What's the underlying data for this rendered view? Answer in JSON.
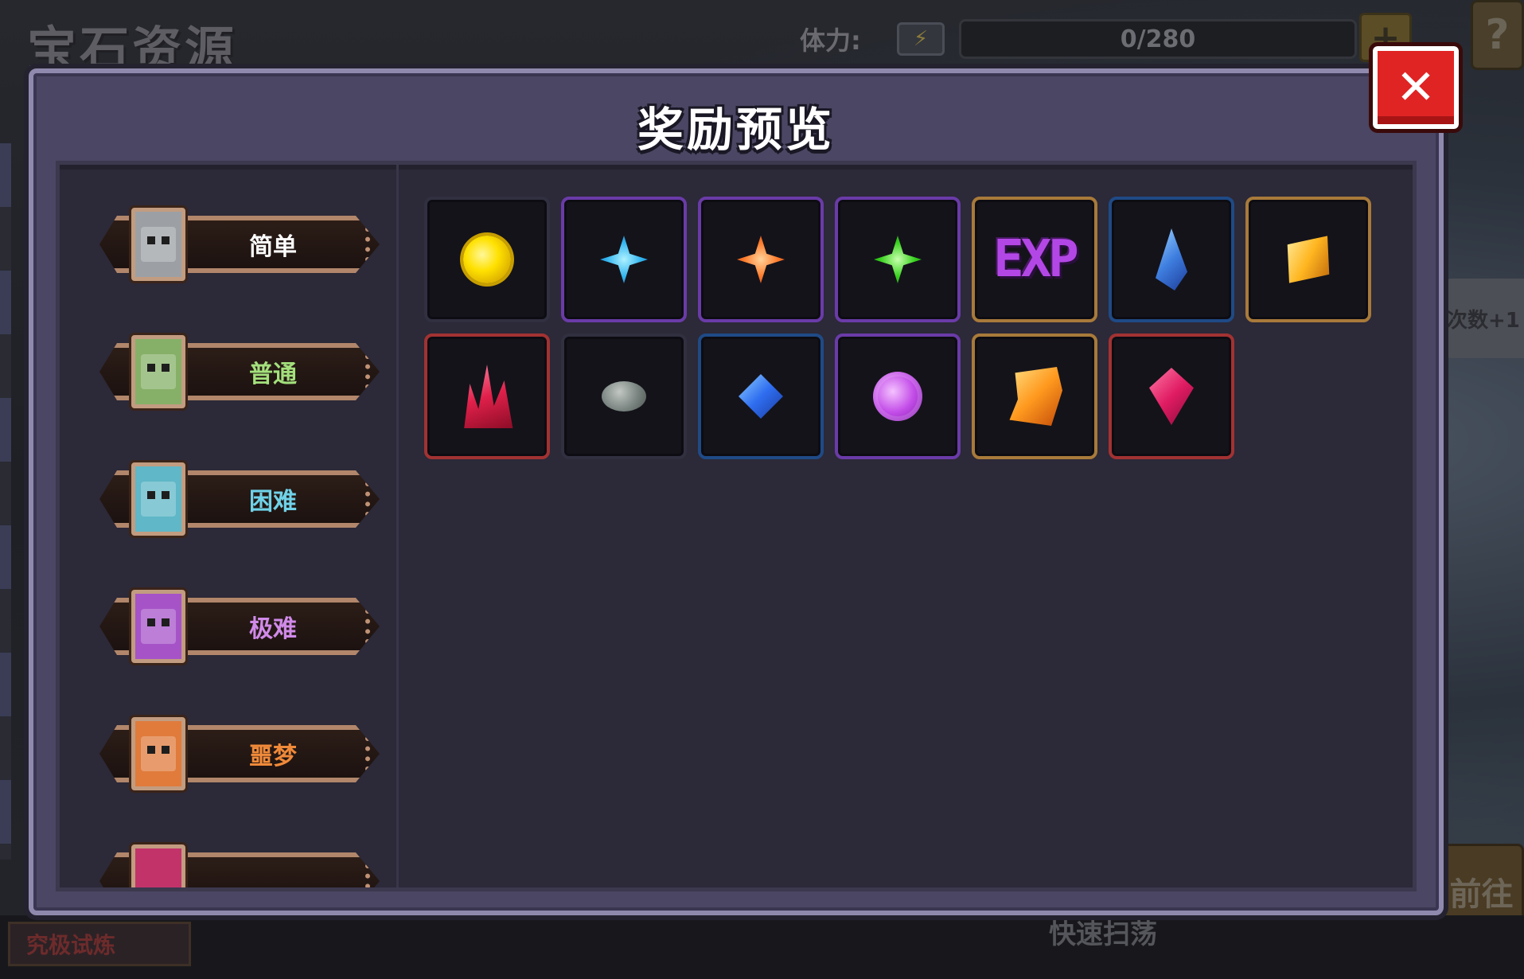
{
  "background": {
    "title": "宝石资源",
    "stamina_label": "体力:",
    "stamina_value": "0/280",
    "side_tag": "次数+1",
    "goto_label": "前往",
    "trial_label": "究极试炼",
    "sweep_label": "快速扫荡"
  },
  "modal": {
    "title": "奖励预览",
    "close_icon": "close-icon",
    "difficulties": [
      {
        "label": "简单",
        "color": "#ffffff",
        "icon_bg": "#9ca0a5",
        "frame": "#c29c80"
      },
      {
        "label": "普通",
        "color": "#a3e07c",
        "icon_bg": "#86b067",
        "frame": "#c29c80"
      },
      {
        "label": "困难",
        "color": "#6fd2e8",
        "icon_bg": "#5fb7c7",
        "frame": "#c29c80"
      },
      {
        "label": "极难",
        "color": "#d08ae8",
        "icon_bg": "#a653c8",
        "frame": "#c29c80"
      },
      {
        "label": "噩梦",
        "color": "#f08a3a",
        "icon_bg": "#e07b3c",
        "frame": "#c29c80"
      }
    ],
    "rewards": [
      {
        "icon": "gold-coin-icon",
        "rarity": "gray"
      },
      {
        "icon": "blue-star-gem-icon",
        "rarity": "purple"
      },
      {
        "icon": "orange-star-gem-icon",
        "rarity": "purple"
      },
      {
        "icon": "green-star-gem-icon",
        "rarity": "purple"
      },
      {
        "icon": "exp-icon",
        "rarity": "orange",
        "text": "EXP"
      },
      {
        "icon": "blue-shard-icon",
        "rarity": "blue"
      },
      {
        "icon": "gold-ticket-icon",
        "rarity": "orange"
      },
      {
        "icon": "red-crystals-icon",
        "rarity": "red"
      },
      {
        "icon": "stone-icon",
        "rarity": "gray"
      },
      {
        "icon": "sapphire-icon",
        "rarity": "blue"
      },
      {
        "icon": "amethyst-icon",
        "rarity": "purple"
      },
      {
        "icon": "gold-scroll-icon",
        "rarity": "orange"
      },
      {
        "icon": "ruby-icon",
        "rarity": "red"
      }
    ]
  }
}
